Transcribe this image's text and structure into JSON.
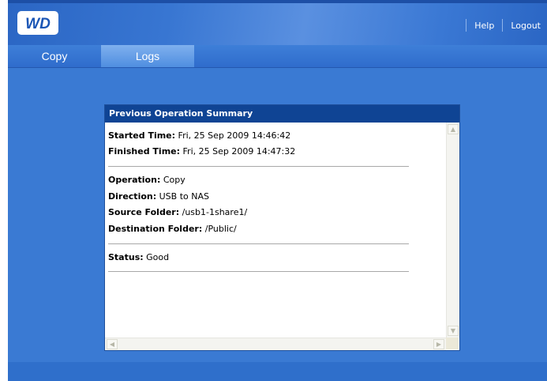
{
  "header": {
    "logo_text": "WD",
    "links": [
      {
        "label": "Help"
      },
      {
        "label": "Logout"
      }
    ]
  },
  "tabs": [
    {
      "label": "Copy",
      "selected": false
    },
    {
      "label": "Logs",
      "selected": true
    }
  ],
  "panel": {
    "title": "Previous Operation Summary",
    "started": {
      "label": "Started Time:",
      "value": "Fri, 25 Sep 2009 14:46:42"
    },
    "finished": {
      "label": "Finished Time:",
      "value": "Fri, 25 Sep 2009 14:47:32"
    },
    "operation": {
      "label": "Operation:",
      "value": "Copy"
    },
    "direction": {
      "label": "Direction:",
      "value": "USB to NAS"
    },
    "source": {
      "label": "Source Folder:",
      "value": "/usb1-1share1/"
    },
    "destination": {
      "label": "Destination Folder:",
      "value": "/Public/"
    },
    "status": {
      "label": "Status:",
      "value": "Good"
    }
  },
  "colors": {
    "header_blue": "#3876d2",
    "main_blue": "#3a7ad3",
    "panel_title_bg": "#0f4494",
    "selected_tab": "#6aa1e8"
  }
}
